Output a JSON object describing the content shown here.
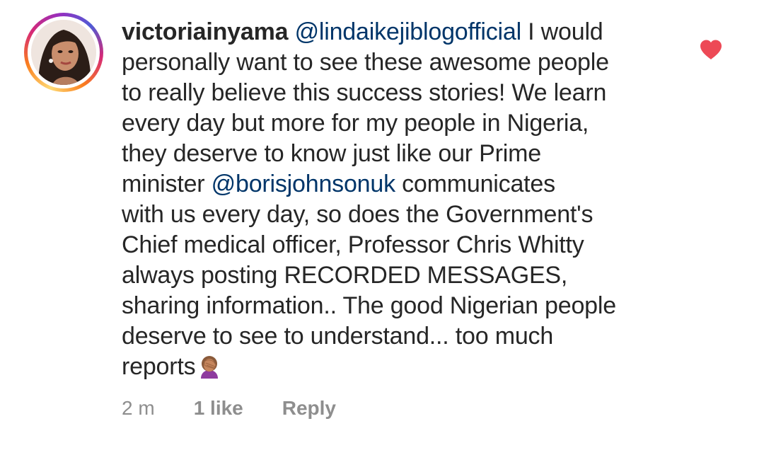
{
  "comment": {
    "username": "victoriainyama",
    "segments": {
      "mention1": "@lindaikejiblogofficial",
      "text1": " I would\npersonally want to see these awesome people\nto really believe this success stories! We learn\nevery day but more for my people in Nigeria,\nthey deserve to know just like our Prime\nminister ",
      "mention2": "@borisjohnsonuk",
      "text2": " communicates\nwith us every day,  so does the Government's\nChief medical officer,  Professor Chris Whitty\nalways posting RECORDED MESSAGES,\nsharing information.. The good Nigerian people\ndeserve to see to understand... too much\nreports"
    },
    "emoji_icon": "face-palm-emoji",
    "liked": true,
    "heart_icon": "heart-filled-icon",
    "heart_color": "#ed4956",
    "mention_color": "#003569"
  },
  "meta": {
    "time": "2 m",
    "likes": "1 like",
    "reply": "Reply"
  },
  "avatar_icon": "profile-avatar"
}
